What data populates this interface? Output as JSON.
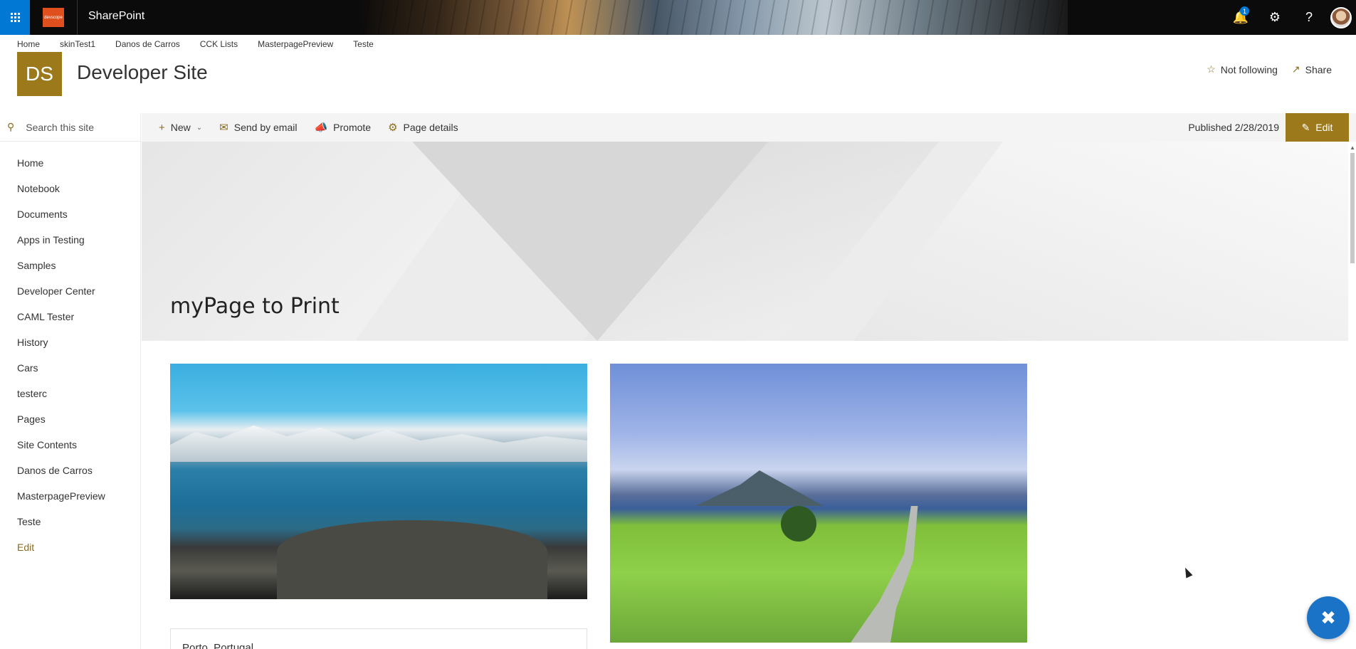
{
  "suite": {
    "logo_text": "devscope",
    "app_title": "SharePoint",
    "notification_count": "1",
    "help_glyph": "?"
  },
  "topnav": [
    "Home",
    "skinTest1",
    "Danos de Carros",
    "CCK Lists",
    "MasterpagePreview",
    "Teste"
  ],
  "site": {
    "logo_initials": "DS",
    "title": "Developer Site",
    "follow_label": "Not following",
    "share_label": "Share"
  },
  "search": {
    "placeholder": "Search this site"
  },
  "leftnav": [
    "Home",
    "Notebook",
    "Documents",
    "Apps in Testing",
    "Samples",
    "Developer Center",
    "CAML Tester",
    "History",
    "Cars",
    "testerc",
    "Pages",
    "Site Contents",
    "Danos de Carros",
    "MasterpagePreview",
    "Teste"
  ],
  "leftnav_edit": "Edit",
  "commandbar": {
    "new_label": "New",
    "email_label": "Send by email",
    "promote_label": "Promote",
    "details_label": "Page details",
    "published": "Published 2/28/2019",
    "edit_label": "Edit"
  },
  "page": {
    "title": "myPage to Print",
    "card_title": "Porto, Portugal"
  },
  "colors": {
    "accent": "#9c7a1b",
    "suitebar": "#0b0b0b",
    "waffle": "#0078d4",
    "fab": "#1b73c8"
  }
}
